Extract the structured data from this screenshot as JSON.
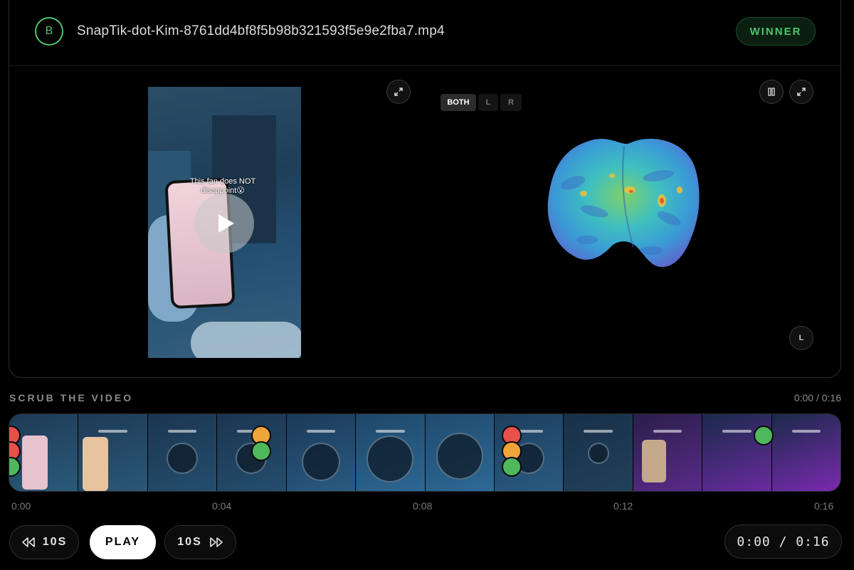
{
  "header": {
    "badge_letter": "B",
    "file_name": "SnapTik-dot-Kim-8761dd4bf8f5b98b321593f5e9e2fba7.mp4",
    "status_label": "WINNER",
    "status_color": "#4fc36b"
  },
  "video": {
    "caption_line1": "This fan does NOT",
    "caption_line2": "disappoint😮"
  },
  "brain_view": {
    "hemisphere_options": [
      "BOTH",
      "L",
      "R"
    ],
    "selected_hemisphere": "BOTH",
    "side_label": "L"
  },
  "icons": {
    "video_expand": "expand-icon",
    "brain_pause": "pause-icon",
    "brain_expand": "expand-icon",
    "play": "play-icon",
    "rewind": "rewind-icon",
    "forward": "fast-forward-icon"
  },
  "scrub": {
    "title": "SCRUB THE VIDEO",
    "time": "0:00 / 0:16",
    "ticks": [
      "0:00",
      "0:04",
      "0:08",
      "0:12",
      "0:16"
    ]
  },
  "controls": {
    "rewind_label": "10S",
    "play_label": "PLAY",
    "forward_label": "10S",
    "time_display": "0:00 / 0:16"
  },
  "colors": {
    "marker_red": "#e8504a",
    "marker_orange": "#f0a53a",
    "marker_green": "#4fb85c"
  }
}
